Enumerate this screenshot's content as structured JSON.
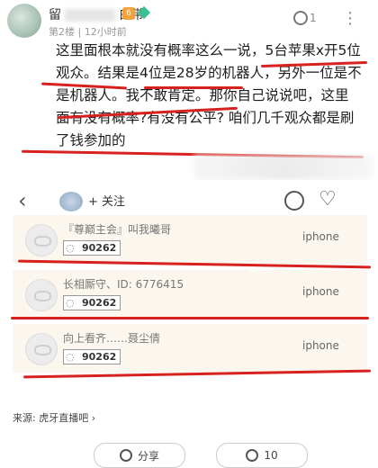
{
  "post": {
    "user_name_prefix": "留",
    "user_name_suffix": "白带",
    "level_badge": "6",
    "floor": "第2楼",
    "time": "12小时前",
    "hu_count": "1",
    "more": "⋮",
    "comment": "这里面根本就没有概率这么一说，5台苹果x开5位观众。结果是4位是28岁的机器人，另外一位是不是机器人。我不敢肯定。那你自己说说吧，这里面有没有概率?有没有公平? 咱们几千观众都是刷了钱参加的"
  },
  "screenshot": {
    "back": "‹",
    "follow": "+ 关注",
    "heart": "♡",
    "winners": [
      {
        "name": "『尊巅主会』叫我曦哥",
        "id_number": "90262",
        "device": "iphone"
      },
      {
        "name": "长相厮守、ID: 6776415",
        "id_number": "90262",
        "device": "iphone"
      },
      {
        "name": "向上看齐……聂尘倩",
        "id_number": "90262",
        "device": "iphone"
      }
    ]
  },
  "source": "来源: 虎牙直播吧 ›",
  "footer": {
    "share_label": "分享",
    "reward_count": "10"
  },
  "colors": {
    "accent_red": "#d7211e",
    "card_bg": "#fbf7ef"
  }
}
